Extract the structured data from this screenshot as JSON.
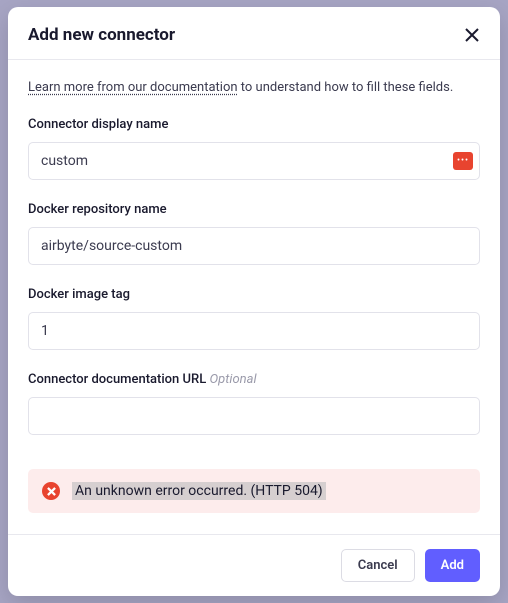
{
  "modal": {
    "title": "Add new connector",
    "help_link_text": "Learn more from our documentation",
    "help_text_rest": " to understand how to fill these fields."
  },
  "fields": {
    "display_name": {
      "label": "Connector display name",
      "value": "custom"
    },
    "docker_repo": {
      "label": "Docker repository name",
      "value": "airbyte/source-custom"
    },
    "docker_tag": {
      "label": "Docker image tag",
      "value": "1"
    },
    "doc_url": {
      "label": "Connector documentation URL",
      "optional": "Optional",
      "value": ""
    }
  },
  "error": {
    "message": "An unknown error occurred. (HTTP 504)"
  },
  "buttons": {
    "cancel": "Cancel",
    "add": "Add"
  }
}
